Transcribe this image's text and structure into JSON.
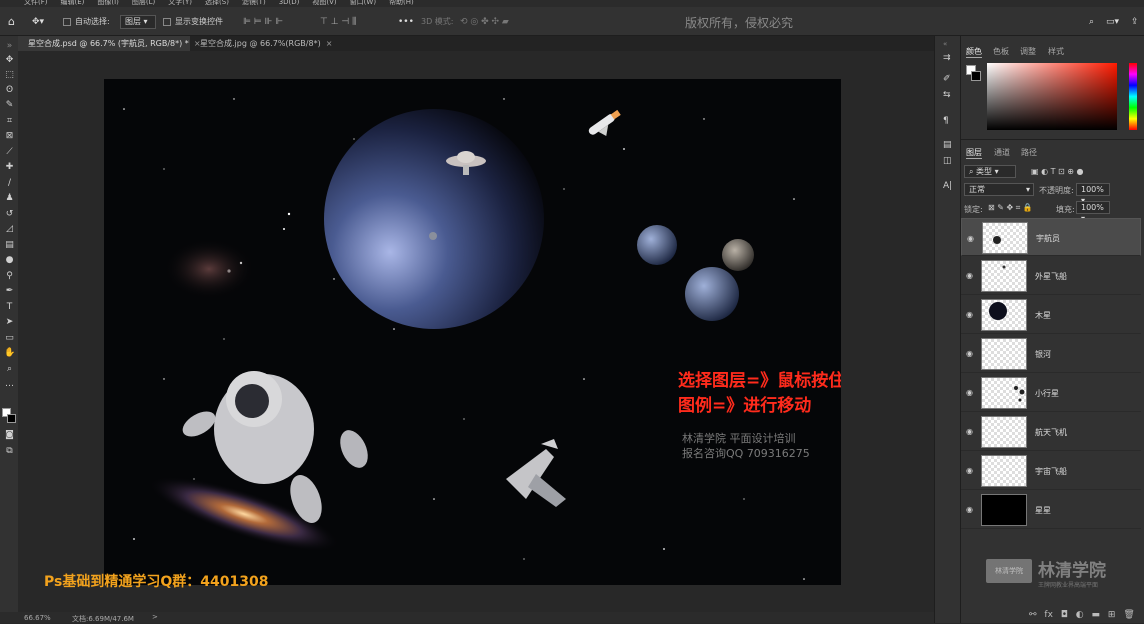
{
  "menu": [
    "文件(F)",
    "编辑(E)",
    "图像(I)",
    "图层(L)",
    "文字(Y)",
    "选择(S)",
    "滤镜(T)",
    "3D(D)",
    "视图(V)",
    "窗口(W)",
    "帮助(H)"
  ],
  "options": {
    "auto_select_label": "自动选择:",
    "auto_select_value": "图层",
    "show_transform_label": "显示变换控件",
    "mode_3d": "3D 模式:",
    "copyright": "版权所有，侵权必究"
  },
  "tabs": [
    {
      "label": "星空合成.psd @ 66.7% (宇航员, RGB/8*) *",
      "close": "×"
    },
    {
      "label": "星空合成.jpg @ 66.7%(RGB/8*)",
      "close": "×"
    }
  ],
  "canvas": {
    "instruction_line1": "选择图层=》鼠标按住图片中的宇航员",
    "instruction_line2": "图例=》进行移动",
    "watermark_line1": "林清学院  平面设计培训",
    "watermark_line2": "报名咨询QQ 709316275"
  },
  "qq_group": "Ps基础到精通学习Q群：4401308",
  "brand": {
    "name": "林清学院",
    "subtitle": "王牌网教业界高端平面",
    "logo_text": "林清学院"
  },
  "status": {
    "zoom": "66.67%",
    "doc": "文档:6.69M/47.6M",
    "arrow": ">"
  },
  "color_panel": {
    "tabs": [
      "颜色",
      "色板",
      "调整",
      "样式"
    ]
  },
  "layers_panel": {
    "tabs": [
      "图层",
      "通道",
      "路径"
    ],
    "filter": "类型",
    "blend_mode": "正常",
    "opacity_label": "不透明度:",
    "opacity_value": "100%",
    "lock_label": "锁定:",
    "fill_label": "填充:",
    "fill_value": "100%",
    "layers": [
      {
        "name": "宇航员",
        "selected": true
      },
      {
        "name": "外星飞船"
      },
      {
        "name": "木星"
      },
      {
        "name": "银河"
      },
      {
        "name": "小行星"
      },
      {
        "name": "航天飞机"
      },
      {
        "name": "宇宙飞船"
      },
      {
        "name": "星星"
      }
    ],
    "footer_icons": [
      "link-icon",
      "fx-icon",
      "mask-icon",
      "adjustment-icon",
      "group-icon",
      "new-layer-icon",
      "trash-icon"
    ]
  },
  "colors": {
    "accent_red": "#ff2b1c",
    "orange": "#f2a21d",
    "canvas_bg": "#050608"
  }
}
